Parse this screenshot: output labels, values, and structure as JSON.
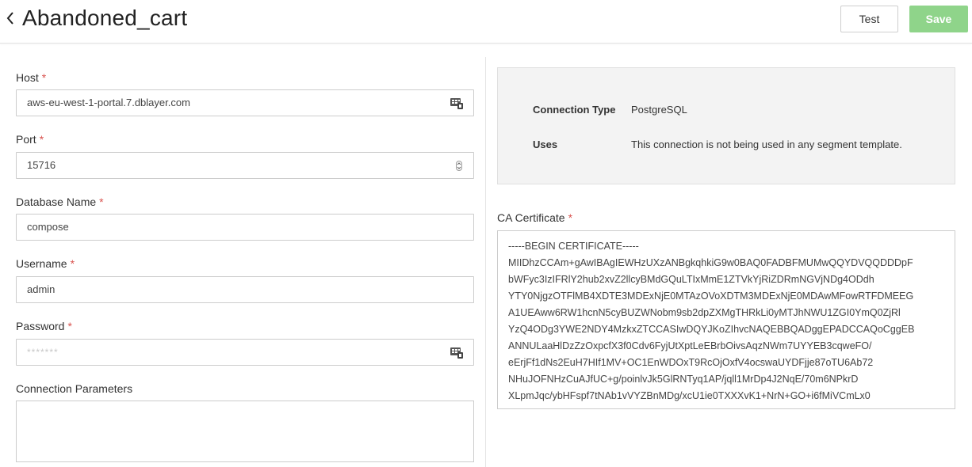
{
  "header": {
    "back_icon": "chevron-left-icon",
    "title": "Abandoned_cart",
    "test_label": "Test",
    "save_label": "Save"
  },
  "form": {
    "host": {
      "label": "Host",
      "required": "*",
      "value": "aws-eu-west-1-portal.7.dblayer.com",
      "icon": "credential-card-icon"
    },
    "port": {
      "label": "Port",
      "required": "*",
      "value": "15716",
      "icon": "stepper-icon"
    },
    "database_name": {
      "label": "Database Name",
      "required": "*",
      "value": "compose"
    },
    "username": {
      "label": "Username",
      "required": "*",
      "value": "admin"
    },
    "password": {
      "label": "Password",
      "required": "*",
      "placeholder": "*******",
      "icon": "credential-card-icon"
    },
    "connection_parameters": {
      "label": "Connection Parameters",
      "value": ""
    }
  },
  "info": {
    "connection_type_label": "Connection Type",
    "connection_type_value": "PostgreSQL",
    "uses_label": "Uses",
    "uses_value": "This connection is not being used in any segment template."
  },
  "certificate": {
    "label": "CA Certificate",
    "required": "*",
    "lines": [
      "-----BEGIN CERTIFICATE-----",
      "MIIDhzCCAm+gAwIBAgIEWHzUXzANBgkqhkiG9w0BAQ0FADBFMUMwQQYDVQQDDDpF",
      "bWFyc3IzIFRlY2hub2xvZ2llcyBMdGQuLTIxMmE1ZTVkYjRiZDRmNGVjNDg4ODdh",
      "YTY0NjgzOTFlMB4XDTE3MDExNjE0MTAzOVoXDTM3MDExNjE0MDAwMFowRTFDMEEG",
      "A1UEAww6RW1hcnN5cyBUZWNobm9sb2dpZXMgTHRkLi0yMTJhNWU1ZGI0YmQ0ZjRl",
      "YzQ4ODg3YWE2NDY4MzkxZTCCASIwDQYJKoZIhvcNAQEBBQADggEPADCCAQoCggEB",
      "ANNULaaHlDzZzOxpcfX3f0Cdv6FyjUtXptLeEBrbOivsAqzNWm7UYYEB3cqweFO/",
      "eErjFf1dNs2EuH7HIf1MV+OC1EnWDOxT9RcOjOxfV4ocswaUYDFjje87oTU6Ab72",
      "NHuJOFNHzCuAJfUC+g/poinlvJk5GlRNTyq1AP/jqll1MrDp4J2NqE/70m6NPkrD",
      "XLpmJqc/ybHFspf7tNAb1vVYZBnMDg/xcU1ie0TXXXvK1+NrN+GO+i6fMiVCmLx0"
    ]
  }
}
